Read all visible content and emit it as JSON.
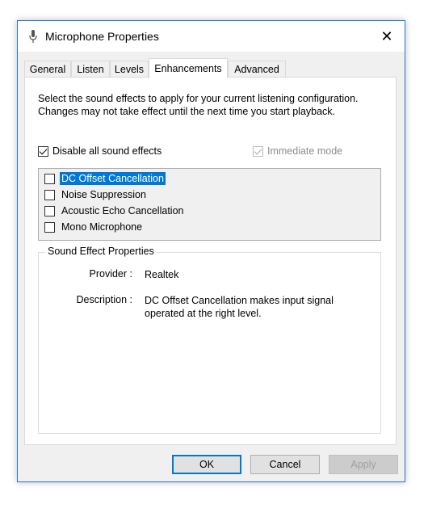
{
  "window": {
    "title": "Microphone Properties",
    "close_glyph": "✕"
  },
  "tabs": [
    {
      "label": "General"
    },
    {
      "label": "Listen"
    },
    {
      "label": "Levels"
    },
    {
      "label": "Enhancements",
      "active": true
    },
    {
      "label": "Advanced"
    }
  ],
  "enhancements": {
    "description": "Select the sound effects to apply for your current listening configuration. Changes may not take effect until the next time you start playback.",
    "disable_all": {
      "label": "Disable all sound effects",
      "checked": true
    },
    "immediate_mode": {
      "label": "Immediate mode",
      "checked": true,
      "enabled": false
    },
    "effects": [
      {
        "label": "DC Offset Cancellation",
        "checked": false,
        "selected": true
      },
      {
        "label": "Noise Suppression",
        "checked": false
      },
      {
        "label": "Acoustic Echo Cancellation",
        "checked": false
      },
      {
        "label": "Mono Microphone",
        "checked": false
      }
    ]
  },
  "properties": {
    "group_title": "Sound Effect Properties",
    "provider_label": "Provider :",
    "provider_value": "Realtek",
    "description_label": "Description :",
    "description_value": "DC Offset Cancellation makes input signal operated at the right level."
  },
  "buttons": {
    "ok": "OK",
    "cancel": "Cancel",
    "apply": "Apply"
  },
  "colors": {
    "accent": "#0078d7",
    "window_border": "#1f79d2"
  }
}
